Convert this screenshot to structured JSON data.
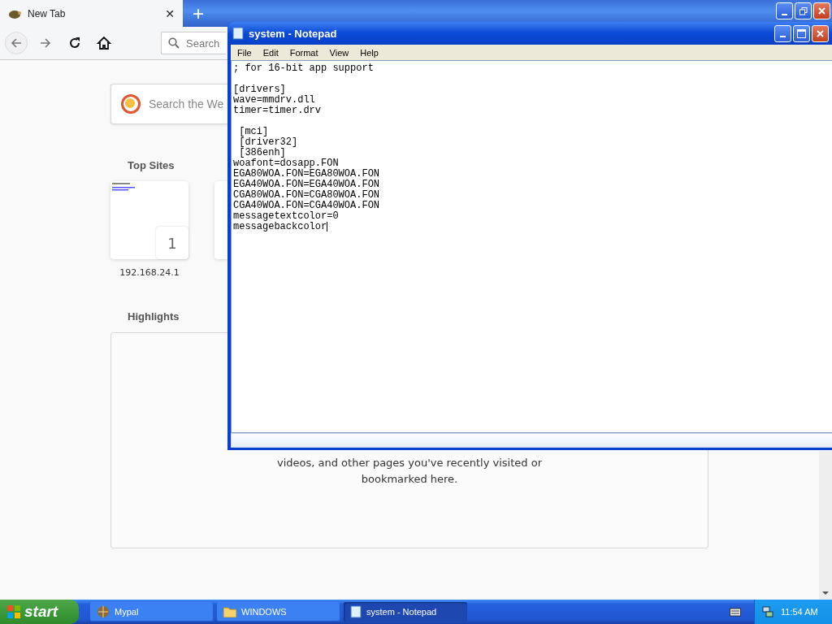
{
  "browser": {
    "tab": {
      "title": "New Tab",
      "close": "✕",
      "selected": true
    },
    "new_tab": "+",
    "toolbar_search": {
      "placeholder": "Search"
    },
    "page": {
      "search": {
        "placeholder": "Search the We"
      },
      "top_sites_heading": "Top Sites",
      "top_sites": [
        {
          "label": "192.168.24.1",
          "badge": "1"
        }
      ],
      "highlights_heading": "Highlights",
      "highlights_text": [
        "videos, and other pages you've recently visited or",
        "bookmarked here."
      ]
    }
  },
  "notepad": {
    "title": "system - Notepad",
    "menu": [
      "File",
      "Edit",
      "Format",
      "View",
      "Help"
    ],
    "blocks": [
      [
        "; for 16-bit app support"
      ],
      [
        "[drivers]",
        "wave=mmdrv.dll",
        "timer=timer.drv"
      ],
      [
        " [mci]",
        " [driver32]",
        " [386enh]",
        "woafont=dosapp.FON",
        "EGA80WOA.FON=EGA80WOA.FON",
        "EGA40WOA.FON=EGA40WOA.FON",
        "CGA80WOA.FON=CGA80WOA.FON",
        "CGA40WOA.FON=CGA40WOA.FON",
        "messagetextcolor=0",
        "messagebackcolor"
      ]
    ]
  },
  "taskbar": {
    "start": "start",
    "buttons": [
      {
        "label": "Mypal",
        "selected": false,
        "kind": "browser"
      },
      {
        "label": "WINDOWS",
        "selected": false,
        "kind": "folder"
      },
      {
        "label": "system - Notepad",
        "selected": true,
        "kind": "notepad"
      }
    ],
    "clock": "11:54 AM"
  }
}
